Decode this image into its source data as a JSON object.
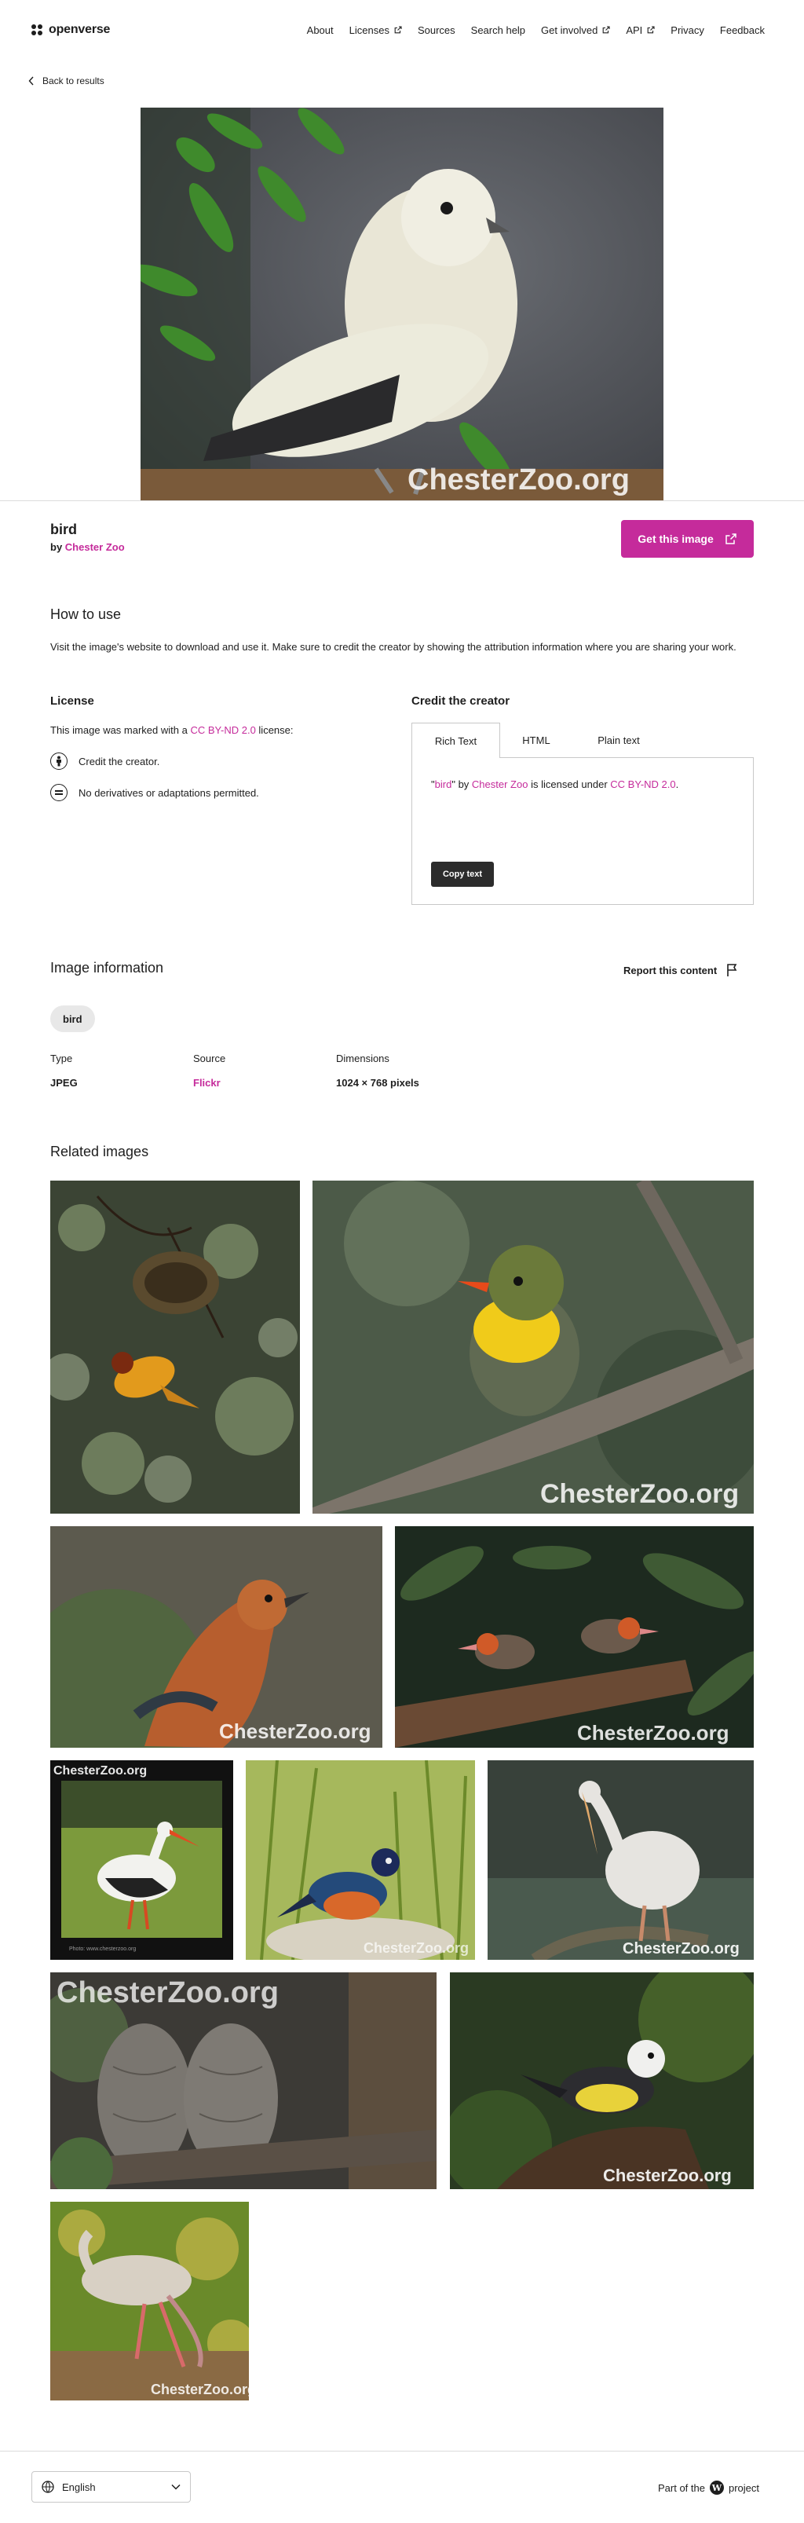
{
  "header": {
    "logo": "openverse",
    "nav": [
      {
        "label": "About",
        "external": false
      },
      {
        "label": "Licenses",
        "external": true
      },
      {
        "label": "Sources",
        "external": false
      },
      {
        "label": "Search help",
        "external": false
      },
      {
        "label": "Get involved",
        "external": true
      },
      {
        "label": "API",
        "external": true
      },
      {
        "label": "Privacy",
        "external": false
      },
      {
        "label": "Feedback",
        "external": false
      }
    ]
  },
  "back_label": "Back to results",
  "image": {
    "watermark": "ChesterZoo.org",
    "title": "bird",
    "by_prefix": "by",
    "creator": "Chester Zoo",
    "get_button": "Get this image"
  },
  "how_to_use": {
    "heading": "How to use",
    "text": "Visit the image's website to download and use it. Make sure to credit the creator by showing the attribution information where you are sharing your work."
  },
  "license": {
    "heading": "License",
    "text_before": "This image was marked with a",
    "license_link": "CC BY-ND 2.0",
    "text_after": "license:",
    "items": [
      "Credit the creator.",
      "No derivatives or adaptations permitted."
    ]
  },
  "credit": {
    "heading": "Credit the creator",
    "tabs": [
      "Rich Text",
      "HTML",
      "Plain text"
    ],
    "active_tab": "Rich Text",
    "q_open": "\"",
    "title_link": "bird",
    "q_close": "\"",
    "by": "by",
    "creator_link": "Chester Zoo",
    "licensed_under": "is licensed under",
    "license_link": "CC BY-ND 2.0",
    "period": ".",
    "copy_button": "Copy text"
  },
  "image_info": {
    "heading": "Image information",
    "report": "Report this content",
    "tag": "bird",
    "type_label": "Type",
    "type_value": "JPEG",
    "source_label": "Source",
    "source_value": "Flickr",
    "dimensions_label": "Dimensions",
    "dimensions_value": "1024 × 768 pixels"
  },
  "related": {
    "heading": "Related images",
    "watermark": "ChesterZoo.org",
    "caption_small": "Photo: www.chesterzoo.org"
  },
  "footer": {
    "language": "English",
    "part_of_prefix": "Part of the",
    "part_of_suffix": "project"
  },
  "colors": {
    "accent": "#c52b9b",
    "text": "#1e1e1e",
    "border": "#c8c8c8",
    "tag_bg": "#e8e8e8",
    "button_dark": "#2c2c2c"
  }
}
